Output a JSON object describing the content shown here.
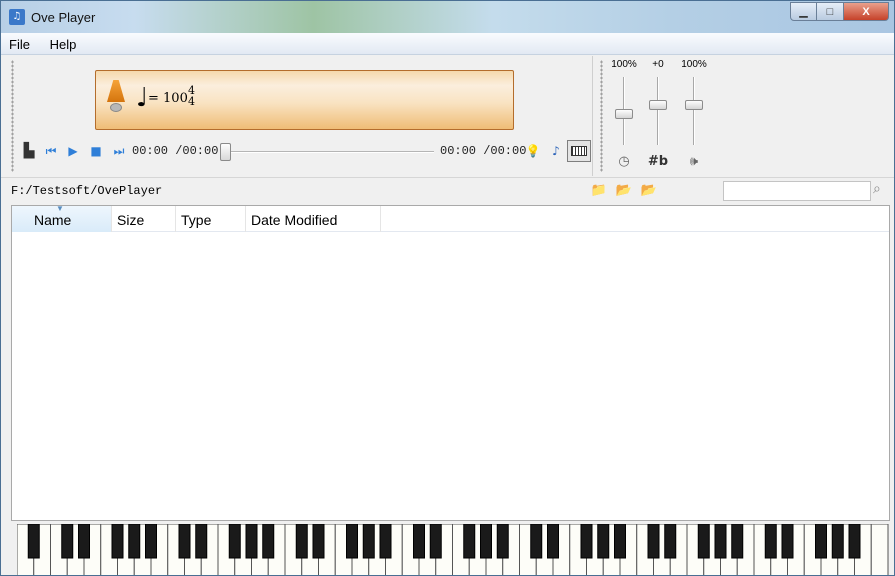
{
  "window": {
    "title": "Ove Player",
    "app_icon": "ja-icon"
  },
  "window_buttons": {
    "minimize": "▁",
    "maximize": "□",
    "close": "X"
  },
  "menu": {
    "items": [
      "File",
      "Help"
    ]
  },
  "display": {
    "tempo": "= 100",
    "time_sig_top": "4",
    "time_sig_bottom": "4",
    "note_glyph": "♩"
  },
  "transport": {
    "time_left": "00:00 /00:00",
    "time_right": "00:00 /00:00",
    "seek_position": 0
  },
  "sliders": [
    {
      "label": "100%",
      "icon": "◷",
      "icon_name": "clock-icon",
      "level": 0.45
    },
    {
      "label": "+0",
      "icon": "#b",
      "icon_name": "sharp-flat-icon",
      "level": 0.6
    },
    {
      "label": "100%",
      "icon": "🕪",
      "icon_name": "speaker-icon",
      "level": 0.6
    }
  ],
  "pathbar": {
    "path": "F:/Testsoft/OvePlayer",
    "search_value": ""
  },
  "filelist": {
    "columns": [
      "Name",
      "Size",
      "Type",
      "Date Modified"
    ],
    "rows": []
  },
  "colors": {
    "display_border": "#b46d2c",
    "accent": "#2f7fd8"
  }
}
